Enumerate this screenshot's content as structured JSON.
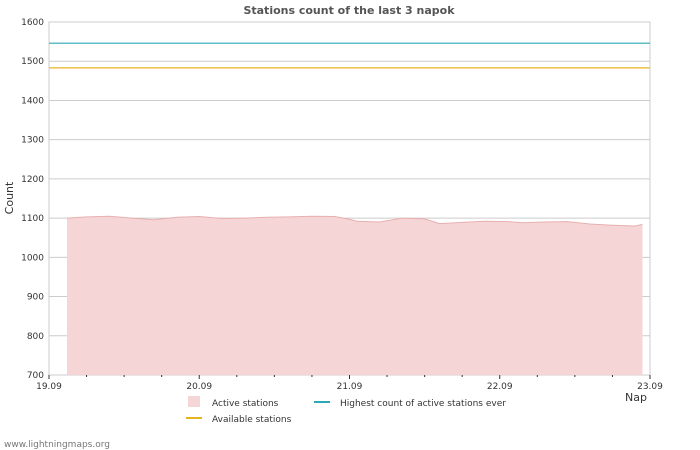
{
  "page": {
    "credit": "www.lightningmaps.org"
  },
  "chart_data": {
    "type": "area",
    "title": "Stations count of the last 3 napok",
    "ylabel": "Count",
    "xlabel": "Nap",
    "ylim": [
      700,
      1600
    ],
    "yticks": [
      700,
      800,
      900,
      1000,
      1100,
      1200,
      1300,
      1400,
      1500,
      1600
    ],
    "xlim": [
      "19.09",
      "23.09"
    ],
    "xticks": [
      "19.09",
      "20.09",
      "21.09",
      "22.09",
      "23.09"
    ],
    "grid": true,
    "series": [
      {
        "name": "Active stations",
        "kind": "area",
        "color": "#f5d5d5",
        "edge_color": "#e8b0b0",
        "x_days": [
          0.12,
          0.25,
          0.4,
          0.55,
          0.7,
          0.85,
          1.0,
          1.15,
          1.3,
          1.45,
          1.6,
          1.75,
          1.9,
          2.0,
          2.05,
          2.2,
          2.35,
          2.5,
          2.6,
          2.75,
          2.9,
          3.05,
          3.15,
          3.3,
          3.45,
          3.6,
          3.75,
          3.9,
          3.95
        ],
        "values": [
          1100,
          1103,
          1105,
          1100,
          1096,
          1102,
          1104,
          1099,
          1100,
          1102,
          1103,
          1105,
          1104,
          1097,
          1092,
          1090,
          1100,
          1098,
          1086,
          1089,
          1092,
          1091,
          1088,
          1090,
          1091,
          1085,
          1082,
          1080,
          1084
        ]
      },
      {
        "name": "Highest count of active stations ever",
        "kind": "line",
        "color": "#2aa9b4",
        "values": [
          1546
        ]
      },
      {
        "name": "Available stations",
        "kind": "line",
        "color": "#e6b422",
        "values": [
          1483
        ]
      }
    ],
    "legend_position": "bottom"
  }
}
